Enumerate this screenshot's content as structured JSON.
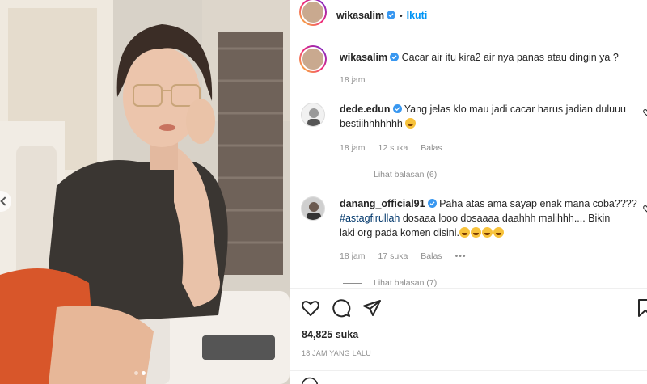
{
  "post": {
    "author": "wikasalim",
    "follow_label": "Ikuti",
    "separator": "•",
    "caption": {
      "author": "wikasalim",
      "text": "Cacar air itu kira2 air nya panas atau dingin ya ?",
      "time": "18 jam"
    },
    "likes": "84,825 suka",
    "time_ago": "18 JAM YANG LALU"
  },
  "comments": [
    {
      "author": "dede.edun",
      "text_line1": "Yang jelas klo mau jadi cacar harus jadian duluuu",
      "text_line2": "bestiihhhhhhh",
      "time": "18 jam",
      "likes": "12 suka",
      "reply_label": "Balas",
      "view_replies": "Lihat balasan (6)"
    },
    {
      "author": "danang_official91",
      "text_line1": "Paha atas ama sayap enak mana coba????",
      "hashtag": "#astagfirullah",
      "text_line2_rest": " dosaaa looo dosaaaa daahhh malihhh.... Bikin",
      "text_line3": "laki org pada komen disini.",
      "time": "18 jam",
      "likes": "17 suka",
      "reply_label": "Balas",
      "more": "•••",
      "view_replies": "Lihat balasan (7)"
    }
  ],
  "colors": {
    "link_blue": "#0095f6",
    "verified_blue": "#3897f0",
    "secondary_text": "#8e8e8e"
  },
  "icons": [
    "verified-badge-icon",
    "heart-icon",
    "comment-icon",
    "share-icon",
    "bookmark-icon",
    "laughing-emoji-icon",
    "chevron-left-icon",
    "more-icon"
  ]
}
